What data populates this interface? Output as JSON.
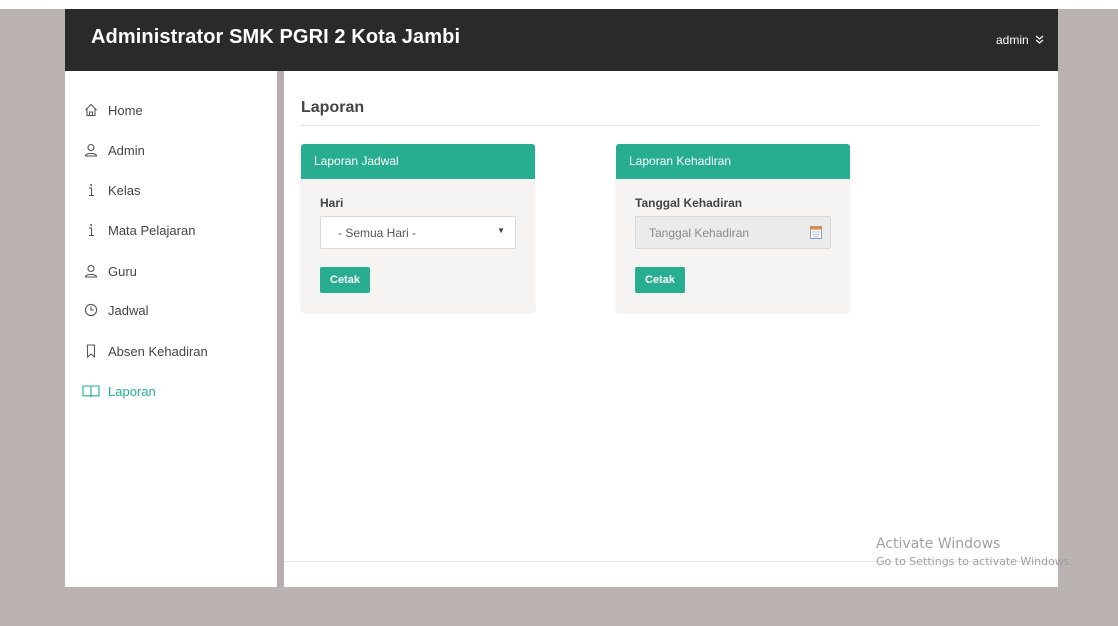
{
  "header": {
    "title": "Administrator SMK PGRI 2 Kota Jambi",
    "user": "admin",
    "user_chevron": "»"
  },
  "sidebar": {
    "items": [
      {
        "label": "Home",
        "icon": "home-icon"
      },
      {
        "label": "Admin",
        "icon": "user-icon"
      },
      {
        "label": "Kelas",
        "icon": "info-icon"
      },
      {
        "label": "Mata Pelajaran",
        "icon": "info-icon"
      },
      {
        "label": "Guru",
        "icon": "user-icon"
      },
      {
        "label": "Jadwal",
        "icon": "clock-icon"
      },
      {
        "label": "Absen Kehadiran",
        "icon": "bookmark-icon"
      },
      {
        "label": "Laporan",
        "icon": "book-icon",
        "active": true
      }
    ]
  },
  "main": {
    "page_title": "Laporan",
    "panels": [
      {
        "heading": "Laporan Jadwal",
        "field_label": "Hari",
        "select_value": "- Semua Hari -",
        "button": "Cetak"
      },
      {
        "heading": "Laporan Kehadiran",
        "field_label": "Tanggal Kehadiran",
        "input_placeholder": "Tanggal Kehadiran",
        "button": "Cetak"
      }
    ]
  },
  "watermark": {
    "line1": "Activate Windows",
    "line2": "Go to Settings to activate Windows."
  },
  "colors": {
    "accent": "#27ae91",
    "header_bg": "#2a2a2a",
    "desktop_bg": "#bbb2b2"
  }
}
